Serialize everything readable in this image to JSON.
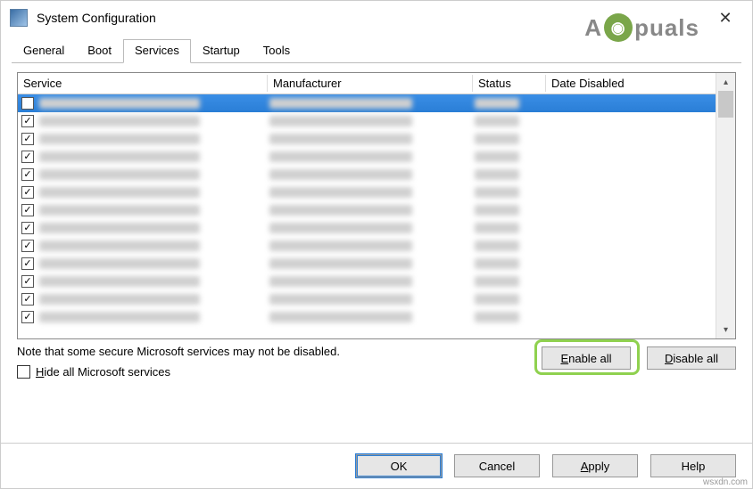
{
  "window": {
    "title": "System Configuration"
  },
  "tabs": {
    "general": "General",
    "boot": "Boot",
    "services": "Services",
    "startup": "Startup",
    "tools": "Tools",
    "active": "services"
  },
  "columns": {
    "service": "Service",
    "manufacturer": "Manufacturer",
    "status": "Status",
    "date_disabled": "Date Disabled"
  },
  "rows": [
    {
      "checked": false,
      "selected": true
    },
    {
      "checked": true,
      "selected": false
    },
    {
      "checked": true,
      "selected": false
    },
    {
      "checked": true,
      "selected": false
    },
    {
      "checked": true,
      "selected": false
    },
    {
      "checked": true,
      "selected": false
    },
    {
      "checked": true,
      "selected": false
    },
    {
      "checked": true,
      "selected": false
    },
    {
      "checked": true,
      "selected": false
    },
    {
      "checked": true,
      "selected": false
    },
    {
      "checked": true,
      "selected": false
    },
    {
      "checked": true,
      "selected": false
    },
    {
      "checked": true,
      "selected": false
    }
  ],
  "note": "Note that some secure Microsoft services may not be disabled.",
  "hide_checkbox": {
    "checked": false,
    "prefix": "H",
    "rest": "ide all Microsoft services"
  },
  "buttons": {
    "enable_all": {
      "prefix": "E",
      "rest": "nable all"
    },
    "disable_all": {
      "prefix": "D",
      "rest": "isable all"
    },
    "ok": "OK",
    "cancel": "Cancel",
    "apply": {
      "prefix": "A",
      "rest": "pply"
    },
    "help": "Help"
  },
  "watermark": {
    "left": "A",
    "right": "puals"
  },
  "source_mark": "wsxdn.com"
}
